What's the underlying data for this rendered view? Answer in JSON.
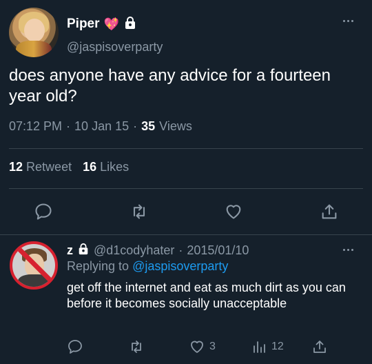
{
  "tweet": {
    "display_name": "Piper",
    "emoji": "💖",
    "handle": "@jaspisoverparty",
    "text": "does anyone have any advice for a fourteen year old?",
    "time": "07:12 PM",
    "date": "10 Jan 15",
    "views_count": "35",
    "views_label": "Views",
    "retweet_count": "12",
    "retweet_label": "Retweet",
    "likes_count": "16",
    "likes_label": "Likes"
  },
  "reply": {
    "display_name": "z",
    "handle": "@d1codyhater",
    "separator": "·",
    "date": "2015/01/10",
    "replying_prefix": "Replying to",
    "replying_to": "@jaspisoverparty",
    "text": "get off the internet and eat as much dirt as you can before it becomes socially unacceptable",
    "like_count": "3",
    "views_count": "12"
  },
  "colors": {
    "background": "#15202b",
    "muted": "#8b98a5",
    "link": "#1d9bf0",
    "divider": "#38444d"
  }
}
